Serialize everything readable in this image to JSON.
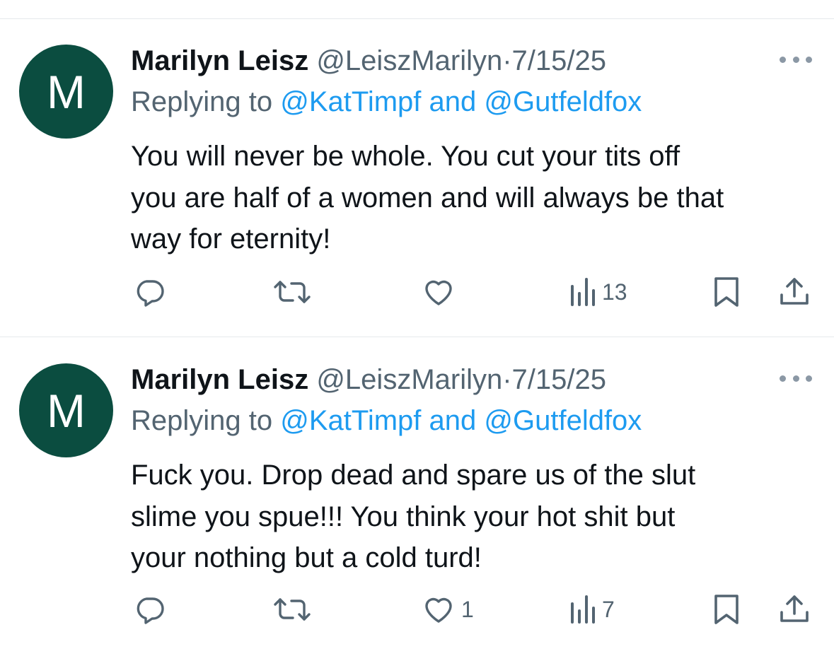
{
  "tweets": [
    {
      "avatar_letter": "M",
      "name": "Marilyn Leisz",
      "handle": "@LeiszMarilyn",
      "separator": "·",
      "date": "7/15/25",
      "replying_prefix": "Replying to",
      "mentions_text": "@KatTimpf and @Gutfeldfox",
      "body_lines": [
        "You will never be whole.  You cut your tits off",
        "you are half of a women and will always be that",
        "way for eternity!"
      ],
      "like_count": "",
      "view_count": "13"
    },
    {
      "avatar_letter": "M",
      "name": "Marilyn Leisz",
      "handle": "@LeiszMarilyn",
      "separator": "·",
      "date": "7/15/25",
      "replying_prefix": "Replying to",
      "mentions_text": "@KatTimpf and @Gutfeldfox",
      "body_lines": [
        "Fuck you.  Drop dead and spare us of the slut",
        "slime you spue!!! You think your hot shit but",
        "your nothing but a cold turd!"
      ],
      "like_count": "1",
      "view_count": "7"
    }
  ],
  "icons": {
    "avatar": "avatar-circle",
    "more": "more-horizontal-icon",
    "reply": "reply-icon",
    "retweet": "retweet-icon",
    "like": "heart-icon",
    "views": "views-bar-chart-icon",
    "bookmark": "bookmark-icon",
    "share": "share-icon"
  },
  "colors": {
    "avatar_bg": "#0b4d40",
    "link": "#1d9bf0",
    "secondary_text": "#536471",
    "icon": "#536471",
    "divider": "#e6e9ec"
  }
}
